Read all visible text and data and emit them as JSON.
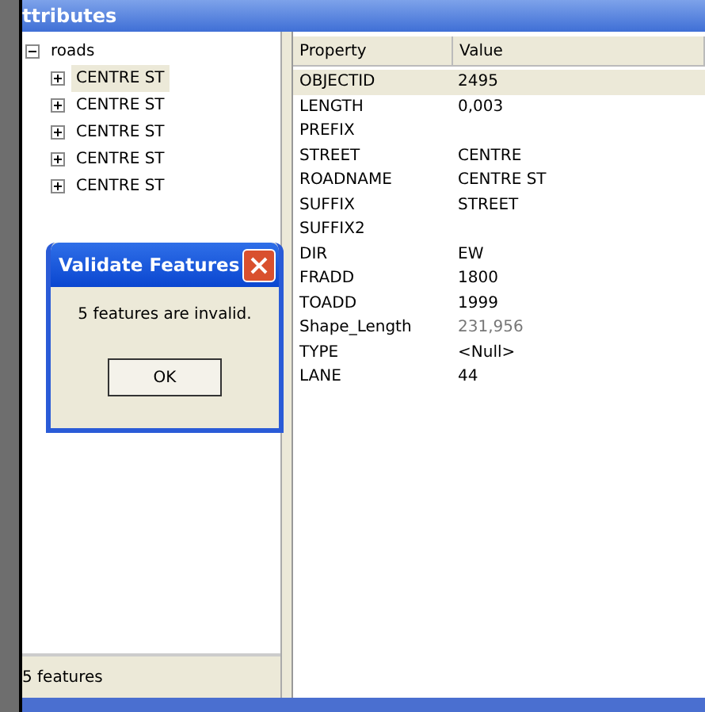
{
  "window": {
    "title": "ttributes"
  },
  "tree": {
    "root": {
      "label": "roads",
      "expanded": true
    },
    "children": [
      {
        "label": "CENTRE ST",
        "expanded": false,
        "selected": true
      },
      {
        "label": "CENTRE ST",
        "expanded": false,
        "selected": false
      },
      {
        "label": "CENTRE ST",
        "expanded": false,
        "selected": false
      },
      {
        "label": "CENTRE ST",
        "expanded": false,
        "selected": false
      },
      {
        "label": "CENTRE ST",
        "expanded": false,
        "selected": false
      }
    ]
  },
  "status_bar": "5 features",
  "table": {
    "columns": [
      "Property",
      "Value"
    ],
    "rows": [
      {
        "property": "OBJECTID",
        "value": "2495",
        "selected": true,
        "readonly": false
      },
      {
        "property": "LENGTH",
        "value": "0,003",
        "selected": false,
        "readonly": false
      },
      {
        "property": "PREFIX",
        "value": "",
        "selected": false
      },
      {
        "property": "STREET",
        "value": "CENTRE",
        "selected": false,
        "readonly": false
      },
      {
        "property": "ROADNAME",
        "value": "CENTRE ST",
        "selected": false,
        "readonly": false
      },
      {
        "property": "SUFFIX",
        "value": "STREET",
        "selected": false,
        "readonly": false
      },
      {
        "property": "SUFFIX2",
        "value": "",
        "selected": false
      },
      {
        "property": "DIR",
        "value": "EW",
        "selected": false,
        "readonly": false
      },
      {
        "property": "FRADD",
        "value": "1800",
        "selected": false,
        "readonly": false
      },
      {
        "property": "TOADD",
        "value": "1999",
        "selected": false,
        "readonly": false
      },
      {
        "property": "Shape_Length",
        "value": "231,956",
        "selected": false,
        "readonly": true
      },
      {
        "property": "TYPE",
        "value": "<Null>",
        "selected": false,
        "readonly": false
      },
      {
        "property": "LANE",
        "value": "44",
        "selected": false,
        "readonly": false
      }
    ]
  },
  "dialog": {
    "title": "Validate Features",
    "message": "5 features are invalid.",
    "button": "OK"
  }
}
